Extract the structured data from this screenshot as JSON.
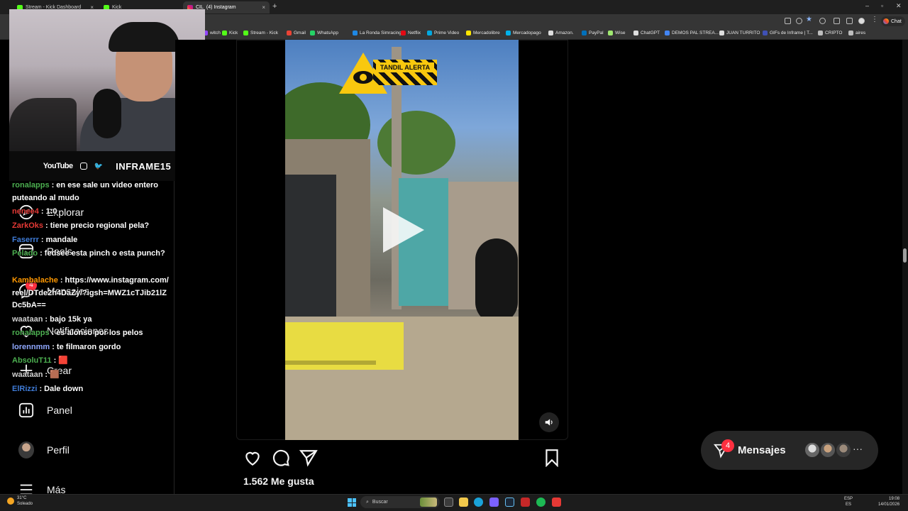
{
  "browser": {
    "tabs": [
      {
        "title": "Stream - Kick Dashboard"
      },
      {
        "title": "Kick"
      },
      {
        "title": "(4) Instagram",
        "prefix": "CIL"
      }
    ],
    "new_tab": "+",
    "chat_button": "Chat",
    "bookmarks": [
      {
        "label": "witch",
        "color": "#9146ff"
      },
      {
        "label": "Kick",
        "color": "#53fc18"
      },
      {
        "label": "Stream - Kick",
        "color": "#53fc18"
      },
      {
        "label": "Gmail",
        "color": "#ea4335"
      },
      {
        "label": "WhatsApp",
        "color": "#25d366"
      },
      {
        "label": "La Ronda Simracing",
        "color": "#1e88e5"
      },
      {
        "label": "Netflix",
        "color": "#e50914"
      },
      {
        "label": "Prime Video",
        "color": "#00a8e1"
      },
      {
        "label": "Mercadolibre",
        "color": "#ffe600"
      },
      {
        "label": "Mercadopago",
        "color": "#00b1ea"
      },
      {
        "label": "Amazon.",
        "color": "#dddddd"
      },
      {
        "label": "PayPal",
        "color": "#0070ba"
      },
      {
        "label": "Wise",
        "color": "#9fe870"
      },
      {
        "label": "ChatGPT",
        "color": "#dddddd"
      },
      {
        "label": "DEMOS PAL STREA...",
        "color": "#4285f4"
      },
      {
        "label": "JUAN TURRITO",
        "color": "#dddddd"
      },
      {
        "label": "GIFs de Inframe | T...",
        "color": "#3f51b5"
      },
      {
        "label": "CRIPTO",
        "color": "#bdbdbd"
      },
      {
        "label": "aires",
        "color": "#bdbdbd"
      }
    ]
  },
  "overlay": {
    "youtube": "YouTube",
    "handle": "INFRAME15",
    "chat": [
      {
        "user": "ronalapps",
        "color": "#4caf50",
        "msg": ": en ese sale un video entero puteando al mudo"
      },
      {
        "user": "nenee4",
        "color": "#e53935",
        "msg": ": 1:0"
      },
      {
        "user": "ZarkOks",
        "color": "#e53935",
        "msg": ": tiene precio regional pela?"
      },
      {
        "user": "Faserrr",
        "color": "#3f7bd6",
        "msg": ": mandale"
      },
      {
        "user": "Pelado",
        "color": "#4caf50",
        "msg": ": fedsee esta pinch o esta punch?"
      },
      {
        "user": "Kambalache",
        "color": "#ff9800",
        "msg": ": https://www.instagram.com/reel/DTde2h4DaZy/?igsh=MWZ1cTJib21lZDc5bA=="
      },
      {
        "user": "waataan",
        "color": "#d0d0d0",
        "msg": ": bajo 15k ya"
      },
      {
        "user": "ronalapps",
        "color": "#4caf50",
        "msg": ": es alonso por los pelos"
      },
      {
        "user": "lorennmm",
        "color": "#8fa8ff",
        "msg": ": te filmaron gordo"
      },
      {
        "user": "AbsoluT11",
        "color": "#4caf50",
        "msg": ": 🟥"
      },
      {
        "user": "waataan",
        "color": "#d0d0d0",
        "msg": ": 🟫"
      },
      {
        "user": "ElRizzi",
        "color": "#3f7bd6",
        "msg": ": Dale down"
      }
    ]
  },
  "instagram": {
    "nav": [
      {
        "label": "Explorar",
        "icon": "compass-icon"
      },
      {
        "label": "Reels",
        "icon": "reels-icon"
      },
      {
        "label": "Mensajes",
        "icon": "messenger-icon",
        "badge": "4"
      },
      {
        "label": "Notificaciones",
        "icon": "heart-icon"
      },
      {
        "label": "Crear",
        "icon": "plus-icon"
      },
      {
        "label": "Panel",
        "icon": "dashboard-icon"
      },
      {
        "label": "Perfil",
        "icon": "profile-avatar"
      },
      {
        "label": "Más",
        "icon": "menu-icon"
      }
    ],
    "post": {
      "sticker_text": "TANDIL ALERTA",
      "likes": "1.562 Me gusta"
    },
    "messages": {
      "label": "Mensajes",
      "badge": "4",
      "more": "···"
    }
  },
  "taskbar": {
    "weather_temp": "31°C",
    "weather_desc": "Soleado",
    "search_placeholder": "Buscar",
    "lang_line1": "ESP",
    "lang_line2": "ES",
    "time": "19:08",
    "date": "14/01/2026"
  }
}
